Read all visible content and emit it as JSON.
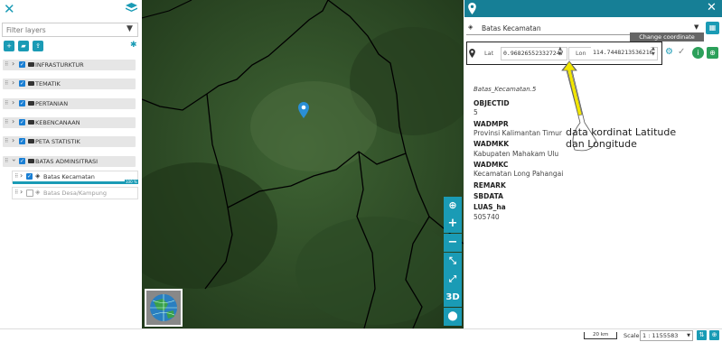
{
  "left_panel": {
    "filter_placeholder": "Filter layers",
    "groups": [
      {
        "label": "INFRASTURKTUR"
      },
      {
        "label": "TEMATIK"
      },
      {
        "label": "PERTANIAN"
      },
      {
        "label": "KEBENCANAAN"
      },
      {
        "label": "PETA STATISTIK"
      },
      {
        "label": "BATAS ADMINSITRASI"
      }
    ],
    "sublayers": [
      {
        "label": "Batas Kecamatan",
        "checked": true
      },
      {
        "label": "Batas Desa/Kampung",
        "checked": false
      }
    ],
    "opacity_badge": "100 %"
  },
  "map": {
    "control_3d": "3D"
  },
  "info_panel": {
    "selected_layer": "Batas Kecamatan",
    "lat_label": "Lat",
    "lat_value": "0.968265523327247",
    "lon_label": "Lon",
    "lon_value": "114.7448213536216",
    "tooltip": "Change coordinate format",
    "feature_id": "Batas_Kecamatan.5",
    "attributes": [
      {
        "key": "OBJECTID",
        "value": "5"
      },
      {
        "key": "WADMPR",
        "value": "Provinsi Kalimantan Timur"
      },
      {
        "key": "WADMKK",
        "value": "Kabupaten Mahakam Ulu"
      },
      {
        "key": "WADMKC",
        "value": "Kecamatan Long Pahangai"
      },
      {
        "key": "REMARK",
        "value": ""
      },
      {
        "key": "SBDATA",
        "value": ""
      },
      {
        "key": "LUAS_ha",
        "value": "505740"
      }
    ]
  },
  "annotation": {
    "line1": "data kordinat Latitude",
    "line2": "dan Longitude"
  },
  "bottom_bar": {
    "scale_bar_label": "20 km",
    "scale_label": "Scale:",
    "scale_value": "1 : 1155583"
  },
  "colors": {
    "accent": "#1a9bb5",
    "header": "#167f96",
    "checkbox": "#1a7fd4",
    "green_button": "#2ca05a"
  }
}
